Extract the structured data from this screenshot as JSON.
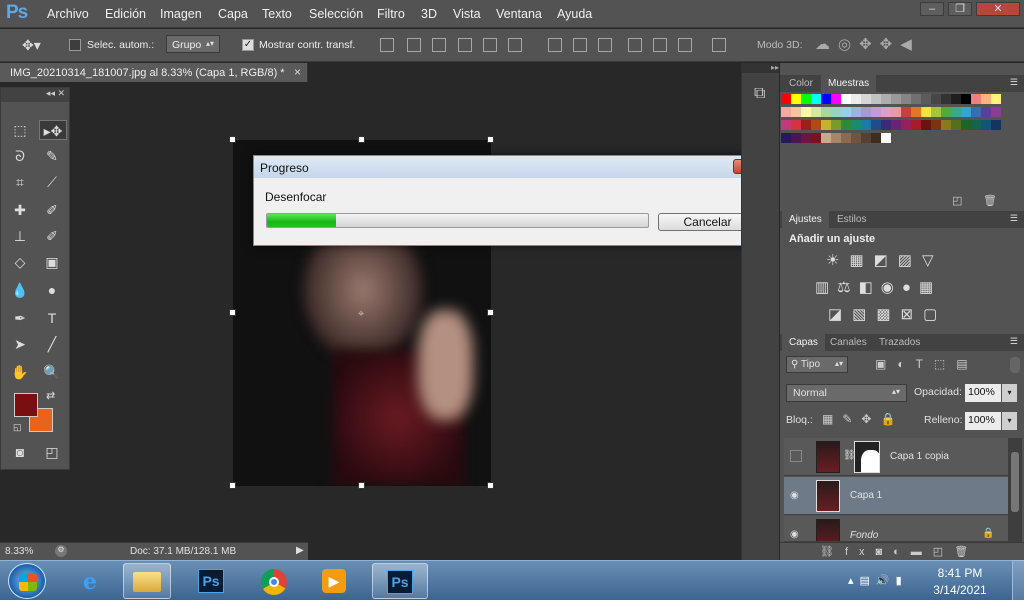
{
  "app": {
    "logo": "Ps"
  },
  "menu": [
    "Archivo",
    "Edición",
    "Imagen",
    "Capa",
    "Texto",
    "Selección",
    "Filtro",
    "3D",
    "Vista",
    "Ventana",
    "Ayuda"
  ],
  "window_controls": {
    "minimize": "–",
    "restore": "❐",
    "close": "✕"
  },
  "options": {
    "auto_select_label": "Selec. autom.:",
    "group_select": "Grupo",
    "show_transform_label": "Mostrar contr. transf.",
    "mode3d_label": "Modo 3D:"
  },
  "document": {
    "tab_title": "IMG_20210314_181007.jpg al 8.33% (Capa 1, RGB/8) *",
    "tab_close": "×",
    "zoom": "8.33%",
    "doc_info": "Doc: 37.1 MB/128.1 MB"
  },
  "dialog": {
    "title": "Progreso",
    "close": "✕",
    "operation": "Desenfocar",
    "progress": 0.18,
    "cancel_label": "Cancelar"
  },
  "panels": {
    "color_tabs": [
      "Color",
      "Muestras"
    ],
    "adjust_tabs": [
      "Ajustes",
      "Estilos"
    ],
    "add_adjustment": "Añadir un ajuste",
    "layers_tabs": [
      "Capas",
      "Canales",
      "Trazados"
    ],
    "filter_kind": "Tipo",
    "blend_mode": "Normal",
    "opacity_label": "Opacidad:",
    "opacity_value": "100%",
    "lock_label": "Bloq.:",
    "fill_label": "Relleno:",
    "fill_value": "100%",
    "layers": [
      {
        "name": "Capa 1 copia",
        "visible": false
      },
      {
        "name": "Capa 1",
        "visible": true
      },
      {
        "name": "Fondo",
        "visible": true
      }
    ]
  },
  "colors": {
    "foreground": "#7a0f12",
    "background": "#e8641c",
    "accent": "#5ea8e6"
  },
  "swatches": [
    "#ff0000",
    "#ffff00",
    "#00ff00",
    "#00ffff",
    "#0000ff",
    "#ff00ff",
    "#ffffff",
    "#ebebeb",
    "#d6d6d6",
    "#c2c2c2",
    "#adadad",
    "#999999",
    "#858585",
    "#707070",
    "#5c5c5c",
    "#474747",
    "#333333",
    "#1f1f1f",
    "#000000",
    "#f07f7f",
    "#f7b47f",
    "#fff27f",
    "#f0a8a0",
    "#f5c49d",
    "#fff7a8",
    "#d7e8a0",
    "#a8d7a0",
    "#98d5c1",
    "#98d0e8",
    "#9fb2dc",
    "#a79ad1",
    "#c39ad1",
    "#e09dc5",
    "#e89aa4",
    "#c8423b",
    "#e57428",
    "#f4e43a",
    "#a4c63b",
    "#52aa3f",
    "#3aa889",
    "#34a4d2",
    "#3b6bb2",
    "#5b3f9a",
    "#8d3c95",
    "#c23a7a",
    "#d6323f",
    "#9e1e1a",
    "#b04a13",
    "#c2b32a",
    "#7a9a2a",
    "#2e8a3a",
    "#1c8a6e",
    "#1a7aa8",
    "#1f4c8a",
    "#3a2a78",
    "#6a2476",
    "#97205a",
    "#a61c2a",
    "#6a1410",
    "#7a340e",
    "#8a7a1c",
    "#54701e",
    "#1c6428",
    "#12644c",
    "#115678",
    "#143462",
    "#26185a",
    "#4a1456",
    "#6e1440",
    "#7a121e",
    "#c7a98b",
    "#a6866a",
    "#8a6b52",
    "#6f543f",
    "#56402f",
    "#3f2d20",
    "#ffffff"
  ],
  "taskbar": {
    "time": "8:41 PM",
    "date": "3/14/2021"
  }
}
